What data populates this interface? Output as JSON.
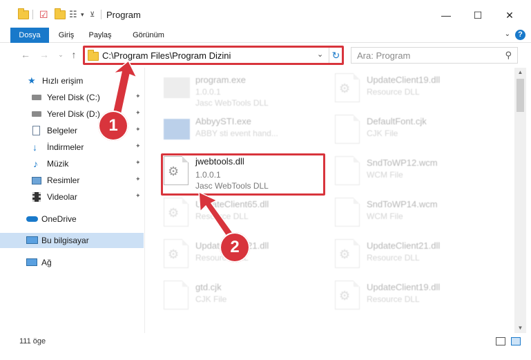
{
  "window": {
    "title": "Program",
    "minimize": "—",
    "maximize": "☐",
    "close": "✕"
  },
  "ribbon": {
    "tabs": [
      {
        "label": "Dosya",
        "active": true
      },
      {
        "label": "Giriş"
      },
      {
        "label": "Paylaş"
      },
      {
        "label": "Görünüm"
      }
    ],
    "help": "?"
  },
  "address": {
    "path": "C:\\Program Files\\Program Dizini",
    "refresh": "↻",
    "dropdown": "⌄"
  },
  "search": {
    "placeholder": "Ara: Program",
    "icon": "⚲"
  },
  "sidebar": {
    "quick_access": "Hızlı erişim",
    "items": [
      {
        "label": "Yerel Disk (C:)",
        "icon": "drive-icon"
      },
      {
        "label": "Yerel Disk (D:)",
        "icon": "drive-icon"
      },
      {
        "label": "Belgeler",
        "icon": "documents-icon"
      },
      {
        "label": "İndirmeler",
        "icon": "download-icon"
      },
      {
        "label": "Müzik",
        "icon": "music-icon"
      },
      {
        "label": "Resimler",
        "icon": "pictures-icon"
      },
      {
        "label": "Videolar",
        "icon": "video-icon"
      }
    ],
    "onedrive": "OneDrive",
    "this_pc": "Bu bilgisayar",
    "network": "Ağ"
  },
  "files": {
    "left": [
      {
        "name": "program.exe",
        "line2": "1.0.0.1",
        "line3": "Jasc WebTools DLL",
        "kind": "exe"
      },
      {
        "name": "AbbyySTI.exe",
        "line2": "ABBY sti event hand...",
        "line3": "",
        "kind": "exe"
      },
      {
        "name": "jwebtools.dll",
        "line2": "1.0.0.1",
        "line3": "Jasc WebTools DLL",
        "kind": "dll"
      },
      {
        "name": "UpdateClient65.dll",
        "line2": "Resource DLL",
        "line3": "",
        "kind": "dll"
      },
      {
        "name": "UpdateClient21.dll",
        "line2": "Resource DLL",
        "line3": "",
        "kind": "dll"
      },
      {
        "name": "gtd.cjk",
        "line2": "CJK File",
        "line3": "",
        "kind": "blank"
      }
    ],
    "right": [
      {
        "name": "UpdateClient19.dll",
        "line2": "Resource DLL",
        "line3": "",
        "kind": "dll"
      },
      {
        "name": "DefaultFont.cjk",
        "line2": "CJK File",
        "line3": "",
        "kind": "blank"
      },
      {
        "name": "SndToWP12.wcm",
        "line2": "WCM File",
        "line3": "",
        "kind": "blank"
      },
      {
        "name": "SndToWP14.wcm",
        "line2": "WCM File",
        "line3": "",
        "kind": "blank"
      },
      {
        "name": "UpdateClient21.dll",
        "line2": "Resource DLL",
        "line3": "",
        "kind": "dll"
      },
      {
        "name": "UpdateClient19.dll",
        "line2": "Resource DLL",
        "line3": "",
        "kind": "dll"
      }
    ]
  },
  "status": {
    "count": "111 öge"
  },
  "annotations": {
    "badge1": "1",
    "badge2": "2",
    "color": "#d8343c"
  }
}
